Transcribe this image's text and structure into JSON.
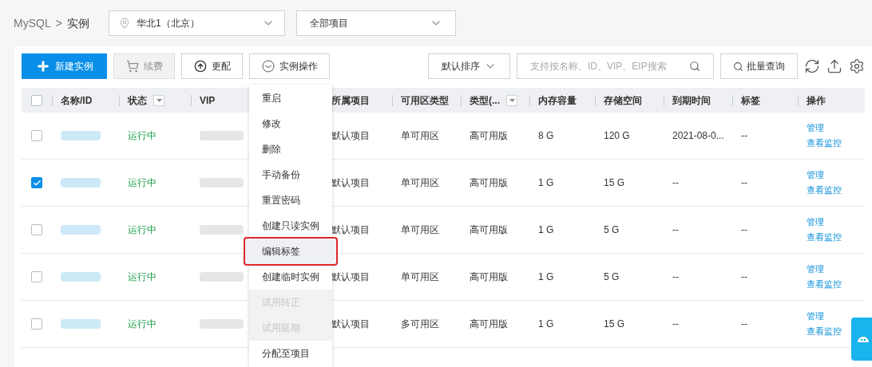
{
  "breadcrumb": {
    "root": "MySQL",
    "separator": ">",
    "current": "实例"
  },
  "region_select": {
    "value": "华北1（北京）"
  },
  "project_select": {
    "value": "全部项目"
  },
  "toolbar": {
    "buttons": [
      {
        "label": "新建实例",
        "kind": "primary",
        "disabled": false
      },
      {
        "label": "续费",
        "kind": "cart",
        "disabled": true
      },
      {
        "label": "更配",
        "kind": "upgrade",
        "disabled": false
      },
      {
        "label": "实例操作",
        "kind": "actions",
        "disabled": false
      }
    ],
    "sort": {
      "value": "默认排序"
    },
    "search": {
      "placeholder": "支持按名称、ID、VIP、EIP搜索"
    },
    "batch_query": "批量查询"
  },
  "table": {
    "header_checked": false,
    "columns": [
      {
        "label": "名称/ID",
        "filter": false
      },
      {
        "label": "状态",
        "filter": true
      },
      {
        "label": "VIP",
        "filter": false
      },
      {
        "label": "所属项目",
        "filter": false
      },
      {
        "label": "可用区类型",
        "filter": false
      },
      {
        "label": "类型(...",
        "filter": true
      },
      {
        "label": "内存容量",
        "filter": false
      },
      {
        "label": "存储空间",
        "filter": false
      },
      {
        "label": "到期时间",
        "filter": false
      },
      {
        "label": "标签",
        "filter": false
      },
      {
        "label": "操作",
        "filter": false
      }
    ],
    "rows": [
      {
        "checked": false,
        "status": "运行中",
        "project": "默认项目",
        "zone_type": "单可用区",
        "type": "高可用版",
        "memory": "8 G",
        "storage": "120 G",
        "expire": "2021-08-0...",
        "tag": "--",
        "actions": [
          "管理",
          "查看监控"
        ]
      },
      {
        "checked": true,
        "status": "运行中",
        "project": "默认项目",
        "zone_type": "单可用区",
        "type": "高可用版",
        "memory": "1 G",
        "storage": "15 G",
        "expire": "--",
        "tag": "--",
        "actions": [
          "管理",
          "查看监控"
        ]
      },
      {
        "checked": false,
        "status": "运行中",
        "project": "默认项目",
        "zone_type": "单可用区",
        "type": "高可用版",
        "memory": "1 G",
        "storage": "5 G",
        "expire": "--",
        "tag": "--",
        "actions": [
          "管理",
          "查看监控"
        ]
      },
      {
        "checked": false,
        "status": "运行中",
        "project": "默认项目",
        "zone_type": "单可用区",
        "type": "高可用版",
        "memory": "1 G",
        "storage": "5 G",
        "expire": "--",
        "tag": "--",
        "actions": [
          "管理",
          "查看监控"
        ]
      },
      {
        "checked": false,
        "status": "运行中",
        "project": "默认项目",
        "zone_type": "多可用区",
        "type": "高可用版",
        "memory": "1 G",
        "storage": "15 G",
        "expire": "--",
        "tag": "--",
        "actions": [
          "管理",
          "查看监控"
        ]
      }
    ]
  },
  "menu": {
    "items": [
      {
        "label": "重启",
        "disabled": false,
        "selected": false
      },
      {
        "label": "修改",
        "disabled": false,
        "selected": false
      },
      {
        "label": "删除",
        "disabled": false,
        "selected": false
      },
      {
        "label": "手动备份",
        "disabled": false,
        "selected": false
      },
      {
        "label": "重置密码",
        "disabled": false,
        "selected": false
      },
      {
        "label": "创建只读实例",
        "disabled": false,
        "selected": false
      },
      {
        "label": "编辑标签",
        "disabled": false,
        "selected": true
      },
      {
        "label": "创建临时实例",
        "disabled": false,
        "selected": false
      },
      {
        "label": "试用转正",
        "disabled": true,
        "selected": false
      },
      {
        "label": "试用延期",
        "disabled": true,
        "selected": false
      },
      {
        "label": "分配至项目",
        "disabled": false,
        "selected": false
      }
    ]
  }
}
